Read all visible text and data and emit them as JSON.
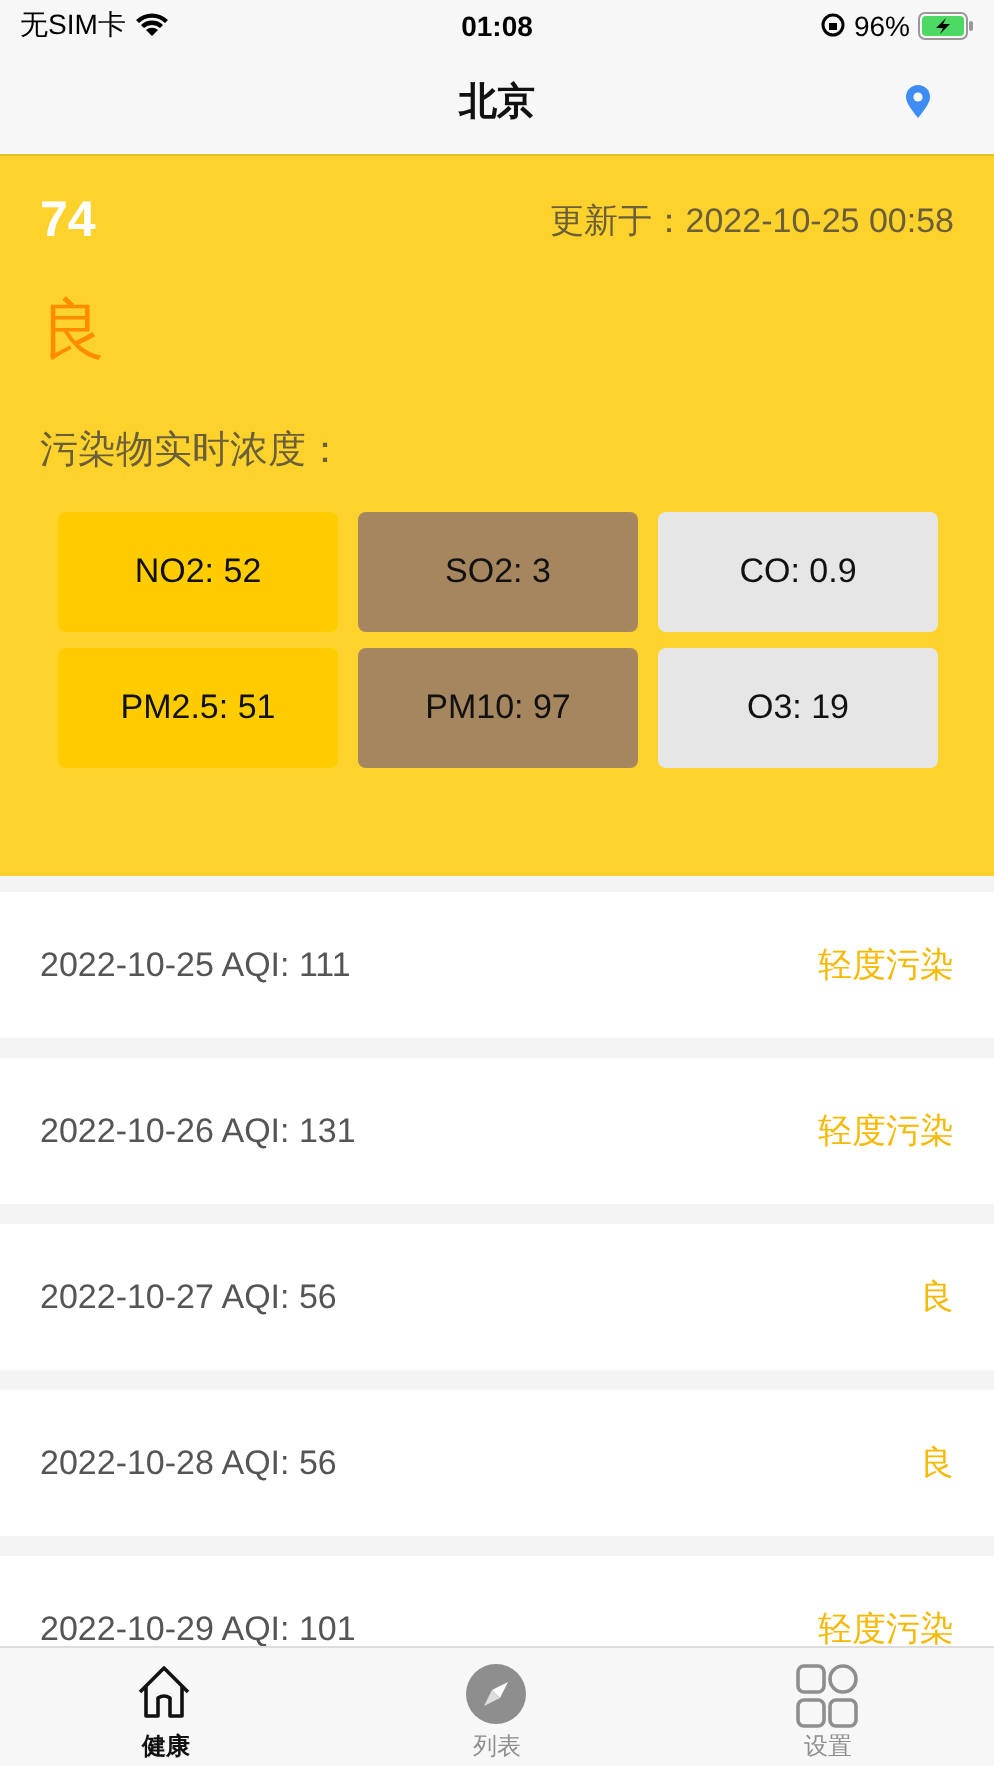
{
  "status_bar": {
    "carrier": "无SIM卡",
    "time": "01:08",
    "battery": "96%"
  },
  "nav": {
    "title": "北京"
  },
  "summary": {
    "aqi": "74",
    "updated": "更新于：2022-10-25 00:58",
    "level": "良",
    "pollutants_label": "污染物实时浓度：",
    "pollutants": [
      {
        "text": "NO2: 52",
        "color": "#ffcc00"
      },
      {
        "text": "SO2: 3",
        "color": "#a5865e"
      },
      {
        "text": "CO: 0.9",
        "color": "#e6e6e6"
      },
      {
        "text": "PM2.5: 51",
        "color": "#ffcc00"
      },
      {
        "text": "PM10: 97",
        "color": "#a5865e"
      },
      {
        "text": "O3: 19",
        "color": "#e6e6e6"
      }
    ]
  },
  "forecast": [
    {
      "text": "2022-10-25 AQI: 111",
      "level": "轻度污染"
    },
    {
      "text": "2022-10-26 AQI: 131",
      "level": "轻度污染"
    },
    {
      "text": "2022-10-27 AQI: 56",
      "level": "良"
    },
    {
      "text": "2022-10-28 AQI: 56",
      "level": "良"
    },
    {
      "text": "2022-10-29 AQI: 101",
      "level": "轻度污染"
    }
  ],
  "tabs": [
    {
      "label": "健康",
      "kind": "home",
      "selected": true
    },
    {
      "label": "列表",
      "kind": "compass",
      "selected": false
    },
    {
      "label": "设置",
      "kind": "grid",
      "selected": false
    }
  ]
}
